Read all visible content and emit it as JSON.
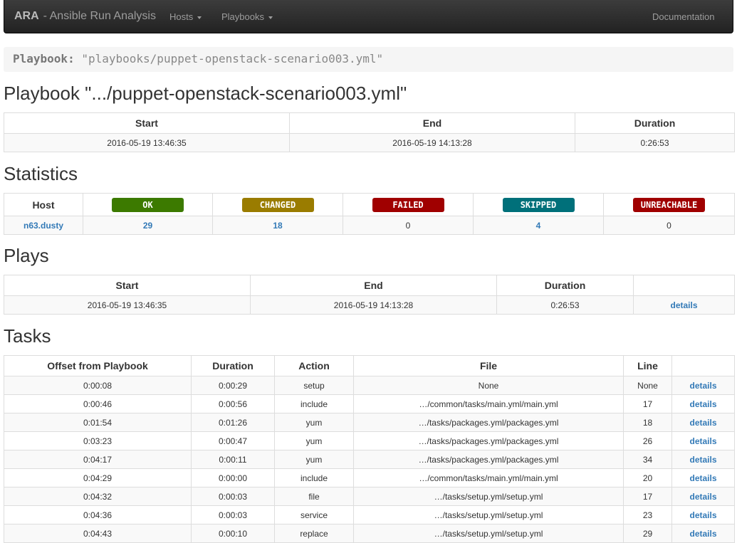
{
  "navbar": {
    "brand_name": "ARA",
    "brand_sub": "- Ansible Run Analysis",
    "hosts_label": "Hosts",
    "playbooks_label": "Playbooks",
    "documentation_label": "Documentation"
  },
  "breadcrumb": {
    "key": "Playbook:",
    "value": "\"playbooks/puppet-openstack-scenario003.yml\""
  },
  "page_title": "Playbook \".../puppet-openstack-scenario003.yml\"",
  "summary": {
    "headers": [
      "Start",
      "End",
      "Duration"
    ],
    "row": [
      "2016-05-19 13:46:35",
      "2016-05-19 14:13:28",
      "0:26:53"
    ]
  },
  "statistics": {
    "title": "Statistics",
    "host_header": "Host",
    "labels": [
      {
        "text": "OK",
        "color": "#3c7a00"
      },
      {
        "text": "CHANGED",
        "color": "#9a7c00"
      },
      {
        "text": "FAILED",
        "color": "#a00000"
      },
      {
        "text": "SKIPPED",
        "color": "#00707a"
      },
      {
        "text": "UNREACHABLE",
        "color": "#a00000"
      }
    ],
    "row": {
      "host": "n63.dusty",
      "ok": "29",
      "changed": "18",
      "failed": "0",
      "skipped": "4",
      "unreachable": "0"
    }
  },
  "plays": {
    "title": "Plays",
    "headers": [
      "Start",
      "End",
      "Duration",
      ""
    ],
    "row": {
      "start": "2016-05-19 13:46:35",
      "end": "2016-05-19 14:13:28",
      "duration": "0:26:53",
      "link": "details"
    }
  },
  "tasks": {
    "title": "Tasks",
    "headers": [
      "Offset from Playbook",
      "Duration",
      "Action",
      "File",
      "Line",
      ""
    ],
    "rows": [
      {
        "offset": "0:00:08",
        "duration": "0:00:29",
        "action": "setup",
        "file": "None",
        "line": "None",
        "link": "details"
      },
      {
        "offset": "0:00:46",
        "duration": "0:00:56",
        "action": "include",
        "file": "…/common/tasks/main.yml/main.yml",
        "line": "17",
        "link": "details"
      },
      {
        "offset": "0:01:54",
        "duration": "0:01:26",
        "action": "yum",
        "file": "…/tasks/packages.yml/packages.yml",
        "line": "18",
        "link": "details"
      },
      {
        "offset": "0:03:23",
        "duration": "0:00:47",
        "action": "yum",
        "file": "…/tasks/packages.yml/packages.yml",
        "line": "26",
        "link": "details"
      },
      {
        "offset": "0:04:17",
        "duration": "0:00:11",
        "action": "yum",
        "file": "…/tasks/packages.yml/packages.yml",
        "line": "34",
        "link": "details"
      },
      {
        "offset": "0:04:29",
        "duration": "0:00:00",
        "action": "include",
        "file": "…/common/tasks/main.yml/main.yml",
        "line": "20",
        "link": "details"
      },
      {
        "offset": "0:04:32",
        "duration": "0:00:03",
        "action": "file",
        "file": "…/tasks/setup.yml/setup.yml",
        "line": "17",
        "link": "details"
      },
      {
        "offset": "0:04:36",
        "duration": "0:00:03",
        "action": "service",
        "file": "…/tasks/setup.yml/setup.yml",
        "line": "23",
        "link": "details"
      },
      {
        "offset": "0:04:43",
        "duration": "0:00:10",
        "action": "replace",
        "file": "…/tasks/setup.yml/setup.yml",
        "line": "29",
        "link": "details"
      }
    ]
  }
}
